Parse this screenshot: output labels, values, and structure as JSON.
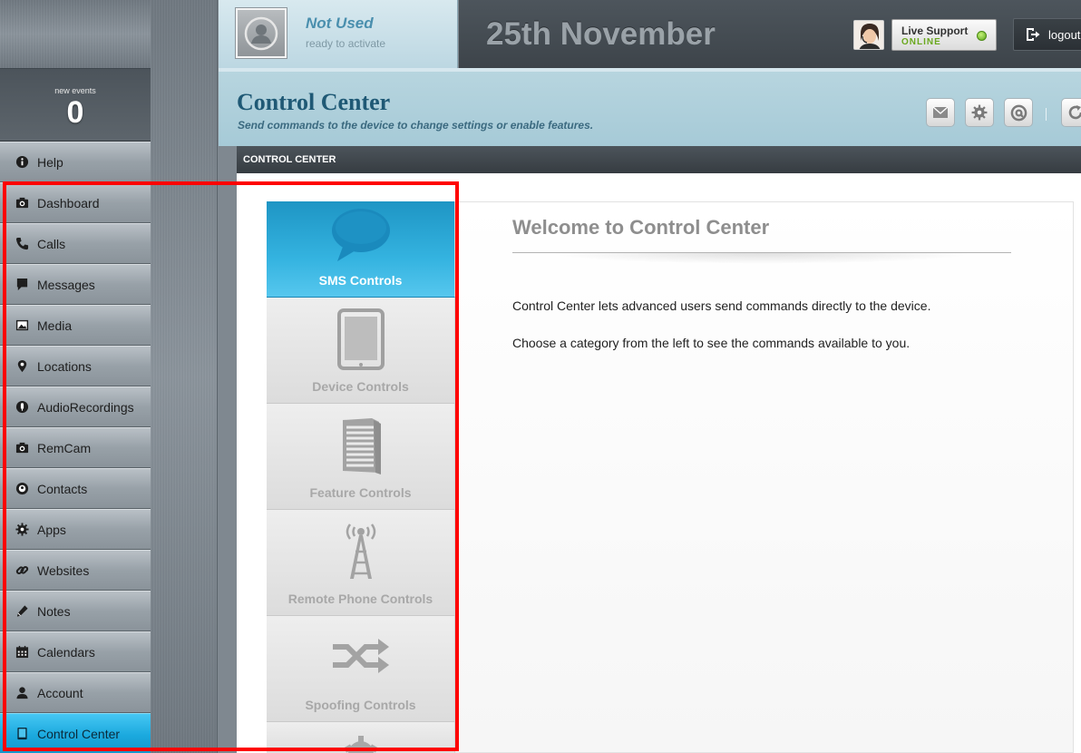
{
  "sidebar": {
    "events_label": "new events",
    "events_count": "0",
    "items": [
      {
        "id": "help",
        "label": "Help",
        "icon": "info-icon",
        "active": false
      },
      {
        "id": "dashboard",
        "label": "Dashboard",
        "icon": "camera-icon",
        "active": false
      },
      {
        "id": "calls",
        "label": "Calls",
        "icon": "phone-icon",
        "active": false
      },
      {
        "id": "messages",
        "label": "Messages",
        "icon": "speech-bubble-icon",
        "active": false
      },
      {
        "id": "media",
        "label": "Media",
        "icon": "image-icon",
        "active": false
      },
      {
        "id": "locations",
        "label": "Locations",
        "icon": "map-pin-icon",
        "active": false
      },
      {
        "id": "audiorecordings",
        "label": "AudioRecordings",
        "icon": "microphone-icon",
        "active": false
      },
      {
        "id": "remcam",
        "label": "RemCam",
        "icon": "camera-icon",
        "active": false
      },
      {
        "id": "contacts",
        "label": "Contacts",
        "icon": "contact-icon",
        "active": false
      },
      {
        "id": "apps",
        "label": "Apps",
        "icon": "gear-icon",
        "active": false
      },
      {
        "id": "websites",
        "label": "Websites",
        "icon": "link-icon",
        "active": false
      },
      {
        "id": "notes",
        "label": "Notes",
        "icon": "pencil-icon",
        "active": false
      },
      {
        "id": "calendars",
        "label": "Calendars",
        "icon": "calendar-icon",
        "active": false
      },
      {
        "id": "account",
        "label": "Account",
        "icon": "user-icon",
        "active": false
      },
      {
        "id": "control-center",
        "label": "Control Center",
        "icon": "tablet-icon",
        "active": true
      }
    ]
  },
  "header": {
    "status_title": "Not Used",
    "status_sub": "ready to activate",
    "date": "25th November",
    "support_title": "Live Support",
    "support_status": "ONLINE",
    "logout_label": "logout"
  },
  "page": {
    "title": "Control Center",
    "subtitle": "Send commands to the device to change settings or enable features.",
    "section_label": "CONTROL CENTER",
    "toolbar_icons": [
      "mail-icon",
      "gear-icon",
      "at-icon",
      "refresh-icon"
    ]
  },
  "categories": [
    {
      "id": "sms",
      "label": "SMS Controls",
      "icon": "speech-bubble-icon",
      "active": true
    },
    {
      "id": "device",
      "label": "Device Controls",
      "icon": "tablet-icon",
      "active": false
    },
    {
      "id": "feature",
      "label": "Feature Controls",
      "icon": "document-icon",
      "active": false
    },
    {
      "id": "remote-phone",
      "label": "Remote Phone Controls",
      "icon": "antenna-icon",
      "active": false
    },
    {
      "id": "spoofing",
      "label": "Spoofing Controls",
      "icon": "shuffle-icon",
      "active": false
    }
  ],
  "welcome": {
    "title": "Welcome to Control Center",
    "para1": "Control Center lets advanced users send commands directly to the device.",
    "para2": "Choose a category from the left to see the commands available to you."
  },
  "colors": {
    "accent": "#1ba9de",
    "highlight": "#ff0000",
    "online": "#6aa81e"
  }
}
